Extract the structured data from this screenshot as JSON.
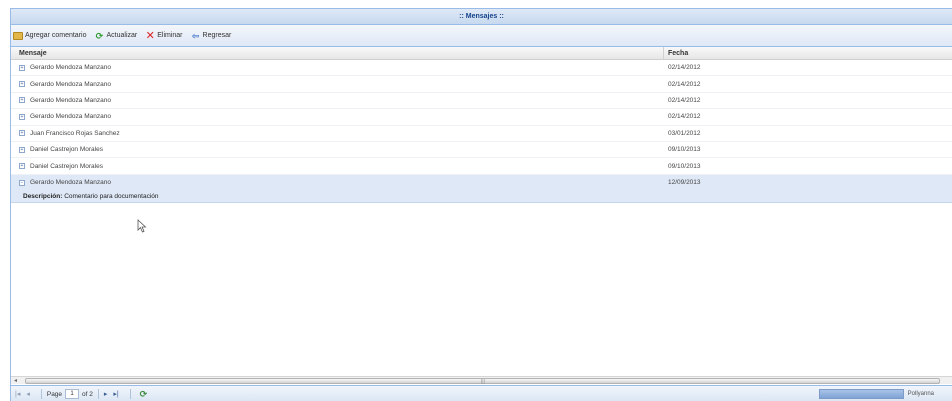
{
  "window": {
    "title": ":: Mensajes ::"
  },
  "toolbar": {
    "add_label": "Agregar comentario",
    "refresh_label": "Actualizar",
    "delete_label": "Eliminar",
    "back_label": "Regresar"
  },
  "grid": {
    "columns": {
      "message": "Mensaje",
      "date": "Fecha"
    },
    "rows": [
      {
        "message": "Gerardo Mendoza Manzano",
        "date": "02/14/2012"
      },
      {
        "message": "Gerardo Mendoza Manzano",
        "date": "02/14/2012"
      },
      {
        "message": "Gerardo Mendoza Manzano",
        "date": "02/14/2012"
      },
      {
        "message": "Gerardo Mendoza Manzano",
        "date": "02/14/2012"
      },
      {
        "message": "Juan Francisco Rojas Sanchez",
        "date": "03/01/2012"
      },
      {
        "message": "Daniel Castrejon Morales",
        "date": "09/10/2013"
      },
      {
        "message": "Daniel Castrejon Morales",
        "date": "09/10/2013"
      },
      {
        "message": "Gerardo Mendoza Manzano",
        "date": "12/09/2013"
      }
    ],
    "expanded_row": {
      "label": "Descripción:",
      "text": "Comentario para documentación"
    }
  },
  "paging": {
    "page_label": "Page",
    "current_page": "1",
    "of_label": "of 2",
    "right_text": "Pollyanna"
  }
}
